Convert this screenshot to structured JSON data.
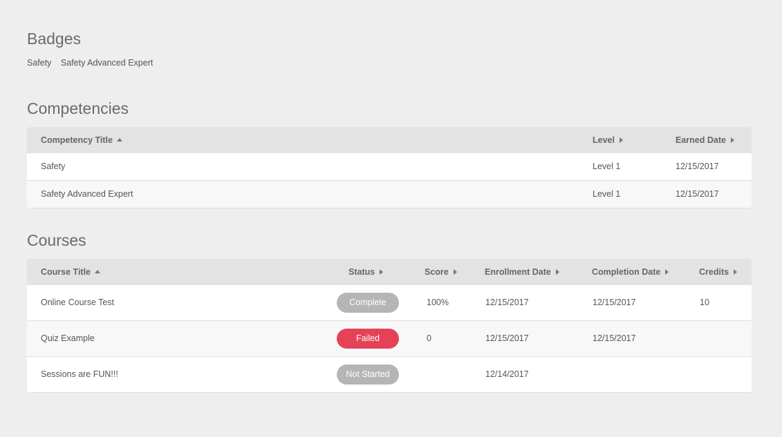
{
  "badges": {
    "title": "Badges",
    "items": [
      "Safety",
      "Safety Advanced Expert"
    ]
  },
  "competencies": {
    "title": "Competencies",
    "headers": {
      "title": "Competency Title",
      "level": "Level",
      "earned_date": "Earned Date"
    },
    "rows": [
      {
        "title": "Safety",
        "level": "Level 1",
        "earned_date": "12/15/2017"
      },
      {
        "title": "Safety Advanced Expert",
        "level": "Level 1",
        "earned_date": "12/15/2017"
      }
    ]
  },
  "courses": {
    "title": "Courses",
    "headers": {
      "title": "Course Title",
      "status": "Status",
      "score": "Score",
      "enrollment_date": "Enrollment Date",
      "completion_date": "Completion Date",
      "credits": "Credits"
    },
    "rows": [
      {
        "title": "Online Course Test",
        "status": "Complete",
        "status_color": "#b5b5b5",
        "score": "100%",
        "enrollment_date": "12/15/2017",
        "completion_date": "12/15/2017",
        "credits": "10"
      },
      {
        "title": "Quiz Example",
        "status": "Failed",
        "status_color": "#e54258",
        "score": "0",
        "enrollment_date": "12/15/2017",
        "completion_date": "12/15/2017",
        "credits": ""
      },
      {
        "title": "Sessions are FUN!!!",
        "status": "Not Started",
        "status_color": "#b5b5b5",
        "score": "",
        "enrollment_date": "12/14/2017",
        "completion_date": "",
        "credits": ""
      }
    ]
  },
  "colors": {
    "background": "#eeeeee",
    "header_bg": "#e3e3e3",
    "failed": "#e54258",
    "neutral_pill": "#b5b5b5"
  }
}
